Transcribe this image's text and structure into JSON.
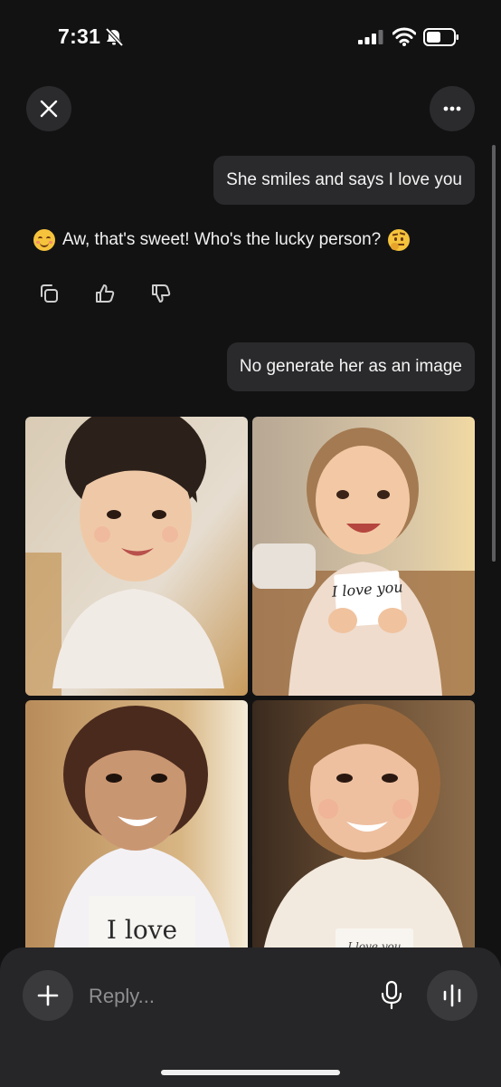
{
  "status_bar": {
    "time": "7:31",
    "icons": [
      "bell-slash-icon",
      "cellular-signal-icon",
      "wifi-icon",
      "battery-icon"
    ]
  },
  "header": {
    "close_icon": "close-icon",
    "more_icon": "ellipsis-icon"
  },
  "conversation": {
    "user_message_1": "She smiles and says I love you",
    "assistant_message": {
      "leading_emoji": "smiling-face-with-smiling-eyes",
      "text": "Aw, that's sweet! Who's the lucky person?",
      "trailing_emoji": "thinking-face"
    },
    "message_actions": [
      "copy-icon",
      "thumbs-up-icon",
      "thumbs-down-icon"
    ],
    "user_message_2": "No generate her as an image",
    "generated_images": [
      {
        "sign_text": ""
      },
      {
        "sign_text": "I love you"
      },
      {
        "sign_text": "I love"
      },
      {
        "sign_text": "I love you"
      }
    ]
  },
  "composer": {
    "placeholder": "Reply...",
    "add_icon": "plus-icon",
    "mic_icon": "microphone-icon",
    "voice_icon": "voice-waveform-icon"
  },
  "colors": {
    "background": "#121213",
    "bubble": "#2a2a2c",
    "composer": "#262628",
    "button": "#3a3a3c"
  }
}
